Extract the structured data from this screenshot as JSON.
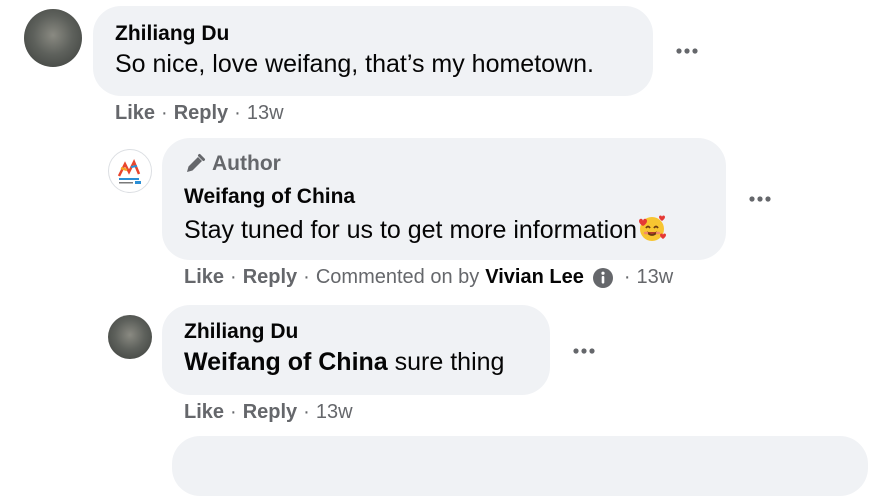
{
  "comment1": {
    "author": "Zhiliang Du",
    "text": "So nice, love weifang, that’s my hometown.",
    "like": "Like",
    "reply": "Reply",
    "sep": "·",
    "time": "13w"
  },
  "comment2": {
    "badge": "Author",
    "author": "Weifang of China",
    "text": "Stay tuned for us to get more information",
    "emoji": "smiling-face-with-hearts",
    "like": "Like",
    "reply": "Reply",
    "sep": "·",
    "commented_on_by": "Commented on by",
    "commenter": "Vivian Lee",
    "time": "13w"
  },
  "comment3": {
    "author": "Zhiliang Du",
    "mention": "Weifang of China",
    "text": " sure thing",
    "like": "Like",
    "reply": "Reply",
    "sep": "·",
    "time": "13w"
  },
  "colors": {
    "bubble": "#f0f2f5",
    "secondary_text": "#65676b",
    "primary_text": "#050505"
  }
}
